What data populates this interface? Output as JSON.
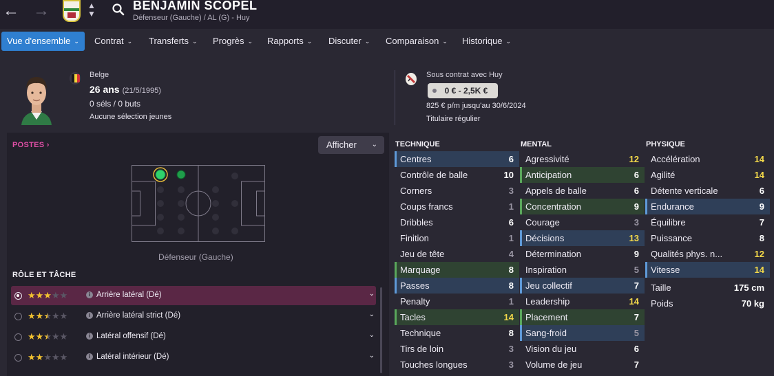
{
  "header": {
    "player_name": "BENJAMIN SCOPEL",
    "subtitle": "Défenseur (Gauche) / AL (G) - Huy"
  },
  "tabs": [
    {
      "label": "Vue d'ensemble",
      "active": true
    },
    {
      "label": "Contrat"
    },
    {
      "label": "Transferts"
    },
    {
      "label": "Progrès"
    },
    {
      "label": "Rapports"
    },
    {
      "label": "Discuter"
    },
    {
      "label": "Comparaison"
    },
    {
      "label": "Historique"
    }
  ],
  "profile": {
    "nationality": "Belge",
    "age": "26 ans",
    "dob": "(21/5/1995)",
    "caps": "0 séls / 0 buts",
    "youth_caps": "Aucune sélection jeunes"
  },
  "contract": {
    "title": "Sous contrat avec Huy",
    "value_range": "0 € - 2,5K €",
    "wage": "825 € p/m jusqu'au 30/6/2024",
    "squad_status": "Titulaire régulier"
  },
  "positions": {
    "title": "POSTES",
    "display_button": "Afficher",
    "label": "Défenseur (Gauche)"
  },
  "roles": {
    "title": "RÔLE ET TÂCHE",
    "items": [
      {
        "name": "Arrière latéral (Dé)",
        "stars": 3,
        "selected": true
      },
      {
        "name": "Arrière latéral strict (Dé)",
        "stars": 2.5,
        "selected": false
      },
      {
        "name": "Latéral offensif (Dé)",
        "stars": 2.5,
        "selected": false
      },
      {
        "name": "Latéral intérieur (Dé)",
        "stars": 2,
        "selected": false
      }
    ]
  },
  "attributes": {
    "technique": {
      "title": "TECHNIQUE",
      "rows": [
        {
          "name": "Centres",
          "value": "6",
          "hl": "blue",
          "tone": "white"
        },
        {
          "name": "Contrôle de balle",
          "value": "10",
          "tone": "white"
        },
        {
          "name": "Corners",
          "value": "3",
          "tone": "gray"
        },
        {
          "name": "Coups francs",
          "value": "1",
          "tone": "gray"
        },
        {
          "name": "Dribbles",
          "value": "6",
          "tone": "white"
        },
        {
          "name": "Finition",
          "value": "1",
          "tone": "gray"
        },
        {
          "name": "Jeu de tête",
          "value": "4",
          "tone": "gray"
        },
        {
          "name": "Marquage",
          "value": "8",
          "hl": "green",
          "tone": "white"
        },
        {
          "name": "Passes",
          "value": "8",
          "hl": "blue",
          "tone": "white"
        },
        {
          "name": "Penalty",
          "value": "1",
          "tone": "gray"
        },
        {
          "name": "Tacles",
          "value": "14",
          "hl": "green",
          "tone": "yellow"
        },
        {
          "name": "Technique",
          "value": "8",
          "tone": "white"
        },
        {
          "name": "Tirs de loin",
          "value": "3",
          "tone": "gray"
        },
        {
          "name": "Touches longues",
          "value": "3",
          "tone": "gray"
        }
      ]
    },
    "mental": {
      "title": "MENTAL",
      "rows": [
        {
          "name": "Agressivité",
          "value": "12",
          "tone": "yellow"
        },
        {
          "name": "Anticipation",
          "value": "6",
          "hl": "green",
          "tone": "white"
        },
        {
          "name": "Appels de balle",
          "value": "6",
          "tone": "white"
        },
        {
          "name": "Concentration",
          "value": "9",
          "hl": "green",
          "tone": "white"
        },
        {
          "name": "Courage",
          "value": "3",
          "tone": "gray"
        },
        {
          "name": "Décisions",
          "value": "13",
          "hl": "blue",
          "tone": "yellow"
        },
        {
          "name": "Détermination",
          "value": "9",
          "tone": "white"
        },
        {
          "name": "Inspiration",
          "value": "5",
          "tone": "gray"
        },
        {
          "name": "Jeu collectif",
          "value": "7",
          "hl": "blue",
          "tone": "white"
        },
        {
          "name": "Leadership",
          "value": "14",
          "tone": "yellow"
        },
        {
          "name": "Placement",
          "value": "7",
          "hl": "green",
          "tone": "white"
        },
        {
          "name": "Sang-froid",
          "value": "5",
          "hl": "blue",
          "tone": "gray"
        },
        {
          "name": "Vision du jeu",
          "value": "6",
          "tone": "white"
        },
        {
          "name": "Volume de jeu",
          "value": "7",
          "tone": "white"
        }
      ]
    },
    "physique": {
      "title": "PHYSIQUE",
      "rows": [
        {
          "name": "Accélération",
          "value": "14",
          "tone": "yellow"
        },
        {
          "name": "Agilité",
          "value": "14",
          "tone": "yellow"
        },
        {
          "name": "Détente verticale",
          "value": "6",
          "tone": "white"
        },
        {
          "name": "Endurance",
          "value": "9",
          "hl": "blue",
          "tone": "white"
        },
        {
          "name": "Équilibre",
          "value": "7",
          "tone": "white"
        },
        {
          "name": "Puissance",
          "value": "8",
          "tone": "white"
        },
        {
          "name": "Qualités phys. n...",
          "value": "12",
          "tone": "yellow"
        },
        {
          "name": "Vitesse",
          "value": "14",
          "hl": "blue",
          "tone": "yellow"
        }
      ],
      "extras": [
        {
          "name": "Taille",
          "value": "175 cm"
        },
        {
          "name": "Poids",
          "value": "70 kg"
        }
      ]
    }
  },
  "colors": {
    "accent": "#2f7fd0",
    "postes": "#e04fa6",
    "selected_role": "#5a2745",
    "high_value": "#f2d84a"
  }
}
